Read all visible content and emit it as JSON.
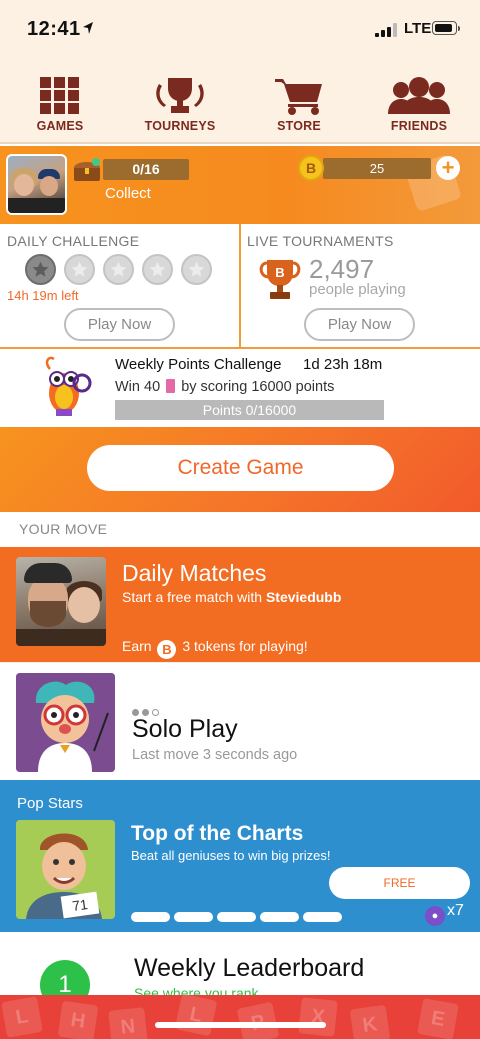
{
  "status": {
    "time": "12:41",
    "network": "LTE"
  },
  "nav": [
    {
      "label": "GAMES",
      "icon": "grid-icon"
    },
    {
      "label": "TOURNEYS",
      "icon": "trophy-icon"
    },
    {
      "label": "STORE",
      "icon": "cart-icon"
    },
    {
      "label": "FRIENDS",
      "icon": "friends-icon"
    }
  ],
  "profile": {
    "chest_progress": "0/16",
    "collect_label": "Collect",
    "token_badge": "B",
    "tokens": "25",
    "plus": "+"
  },
  "daily_challenge": {
    "title": "DAILY CHALLENGE",
    "stars_completed": 1,
    "stars_total": 5,
    "time_left": "14h 19m left",
    "button": "Play Now"
  },
  "live_tournaments": {
    "title": "LIVE TOURNAMENTS",
    "count": "2,497",
    "label": "people playing",
    "button": "Play Now"
  },
  "weekly_points": {
    "title": "Weekly Points Challenge",
    "time": "1d 23h 18m",
    "prefix": "Win 40",
    "suffix": "by scoring 16000 points",
    "progress": "Points 0/16000"
  },
  "create_game": {
    "label": "Create Game"
  },
  "your_move": {
    "label": "YOUR MOVE"
  },
  "daily_matches": {
    "title": "Daily Matches",
    "sub_prefix": "Start a free match with ",
    "friend": "Steviedubb",
    "earn_prefix": "Earn",
    "earn_badge": "B",
    "earn_suffix": "3 tokens for playing!"
  },
  "solo_play": {
    "title": "Solo Play",
    "subtitle": "Last move 3 seconds ago"
  },
  "pop_stars": {
    "section": "Pop Stars",
    "title": "Top of the Charts",
    "subtitle": "Beat all geniuses to win big prizes!",
    "button": "FREE",
    "hints_count": "x7",
    "card_number": "71"
  },
  "leaderboard": {
    "rank": "1",
    "title": "Weekly Leaderboard",
    "subtitle": "See where you rank"
  },
  "colors": {
    "orange": "#f7931e",
    "red_orange": "#f26c21",
    "blue": "#2e8fcf",
    "green": "#2ec14a",
    "brown": "#7a2a1e"
  }
}
